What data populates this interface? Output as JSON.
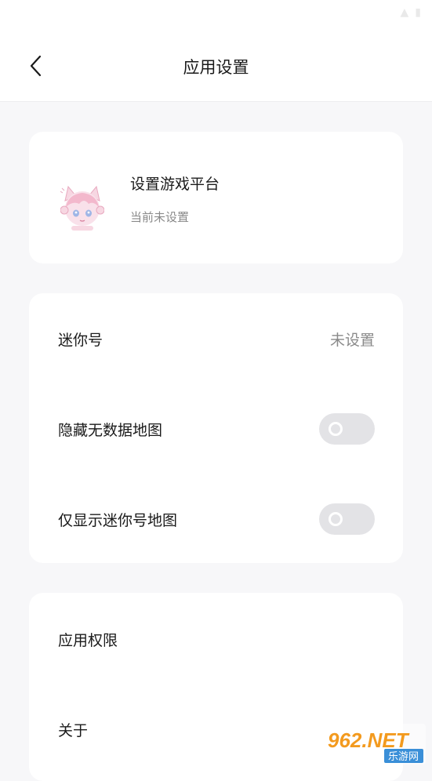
{
  "header": {
    "title": "应用设置"
  },
  "platform_card": {
    "title": "设置游戏平台",
    "subtitle": "当前未设置",
    "avatar_icon": "anime-cat-girl-avatar"
  },
  "settings": {
    "mini_id": {
      "label": "迷你号",
      "value": "未设置"
    },
    "hide_no_data_maps": {
      "label": "隐藏无数据地图",
      "enabled": false
    },
    "only_mini_id_maps": {
      "label": "仅显示迷你号地图",
      "enabled": false
    }
  },
  "misc": {
    "permissions": {
      "label": "应用权限"
    },
    "about": {
      "label": "关于"
    }
  },
  "watermark": {
    "text": "962.NET",
    "subtext": "乐游网"
  },
  "colors": {
    "background": "#f7f7f9",
    "card": "#ffffff",
    "toggle_off": "#e3e3e6",
    "secondary_text": "#8a8a8a",
    "watermark_orange": "#f39a1e"
  }
}
